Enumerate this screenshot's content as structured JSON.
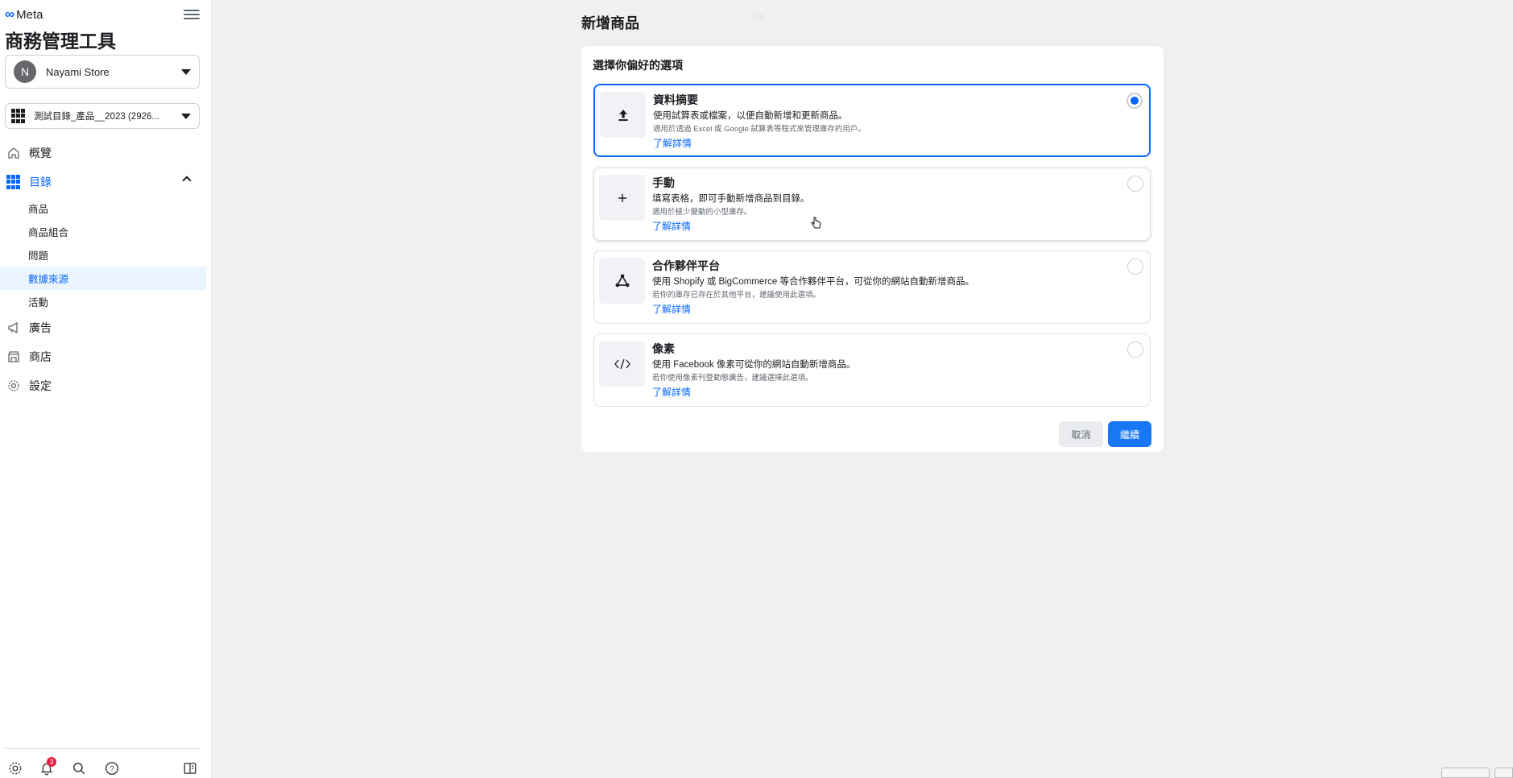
{
  "brand": {
    "logo_text": "Meta",
    "app_title": "商務管理工具"
  },
  "store": {
    "avatar_initial": "N",
    "name": "Nayami Store"
  },
  "catalog": {
    "name": "測試目錄_產品__2023 (2926..."
  },
  "nav": {
    "overview": "概覽",
    "catalog": "目錄",
    "sub": [
      "商品",
      "商品組合",
      "問題",
      "數據來源",
      "活動"
    ],
    "ads": "廣告",
    "shop": "商店",
    "settings": "設定"
  },
  "bottom": {
    "notification_count": "3"
  },
  "page": {
    "title": "新增商品",
    "step": "1/4"
  },
  "card": {
    "heading": "選擇你偏好的選項",
    "options": [
      {
        "title": "資料摘要",
        "desc": "使用試算表或檔案，以便自動新增和更新商品。",
        "note": "適用於透過 Excel 或 Google 試算表等程式來管理庫存的用戶。",
        "link": "了解詳情",
        "icon": "upload-icon",
        "selected": true
      },
      {
        "title": "手動",
        "desc": "填寫表格，即可手動新增商品到目錄。",
        "note": "適用於極少變動的小型庫存。",
        "link": "了解詳情",
        "icon": "plus-icon",
        "selected": false
      },
      {
        "title": "合作夥伴平台",
        "desc": "使用 Shopify 或 BigCommerce 等合作夥伴平台，可從你的網站自動新增商品。",
        "note": "若你的庫存已存在於其他平台，建議使用此選項。",
        "link": "了解詳情",
        "icon": "network-icon",
        "selected": false
      },
      {
        "title": "像素",
        "desc": "使用 Facebook 像素可從你的網站自動新增商品。",
        "note": "若你使用像素刊登動態廣告，建議選擇此選項。",
        "link": "了解詳情",
        "icon": "code-icon",
        "selected": false
      }
    ],
    "cancel_label": "取消",
    "continue_label": "繼續"
  },
  "colors": {
    "accent": "#0866ff",
    "primary_button": "#1877f2"
  }
}
